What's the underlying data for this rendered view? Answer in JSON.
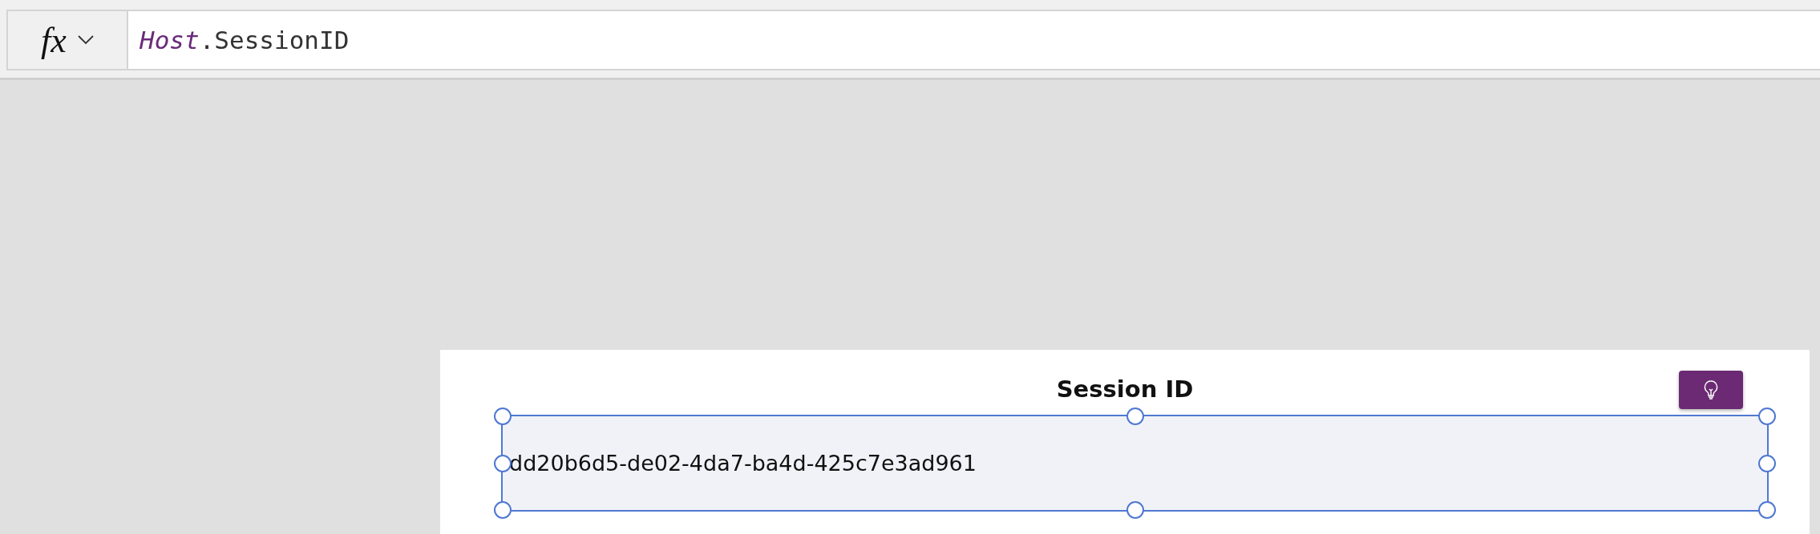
{
  "formula_bar": {
    "function_button": "fx",
    "formula": [
      {
        "kind": "object",
        "text": "Host"
      },
      {
        "kind": "member",
        "text": ".SessionID"
      }
    ]
  },
  "screen": {
    "title": "Session ID",
    "label": {
      "value": "dd20b6d5-de02-4da7-ba4d-425c7e3ad961",
      "selected": true
    }
  }
}
